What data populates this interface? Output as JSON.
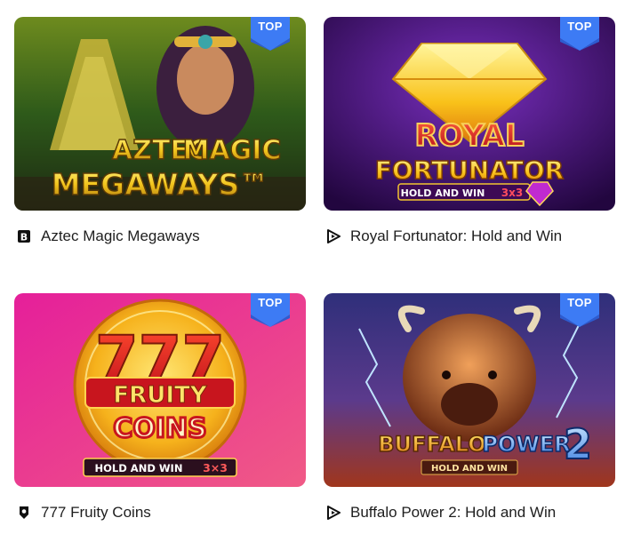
{
  "games": [
    {
      "title": "Aztec Magic Megaways",
      "badge": "TOP",
      "provider_icon": "b-square-icon",
      "art_lines": [
        "AZTEC",
        "MAGIC",
        "MEGAWAYS™"
      ],
      "colors": {
        "bg": "#2f5a1e",
        "accent": "#f3c623"
      }
    },
    {
      "title": "Royal Fortunator: Hold and Win",
      "badge": "TOP",
      "provider_icon": "play-arrow-icon",
      "art_lines": [
        "ROYAL",
        "FORTUNATOR",
        "HOLD AND WIN",
        "3x3"
      ],
      "colors": {
        "bg": "#3a0f6b",
        "accent": "#f8c31a"
      }
    },
    {
      "title": "777 Fruity Coins",
      "badge": "TOP",
      "provider_icon": "shield-icon",
      "art_lines": [
        "777",
        "FRUITY",
        "COINS",
        "HOLD AND WIN",
        "3×3"
      ],
      "colors": {
        "bg": "#e0259b",
        "accent": "#f6b21c"
      }
    },
    {
      "title": "Buffalo Power 2: Hold and Win",
      "badge": "TOP",
      "provider_icon": "play-arrow-icon",
      "art_lines": [
        "BUFFALO",
        "POWER",
        "2",
        "HOLD AND WIN"
      ],
      "colors": {
        "bg": "#26346f",
        "accent": "#f0a21a"
      }
    }
  ]
}
